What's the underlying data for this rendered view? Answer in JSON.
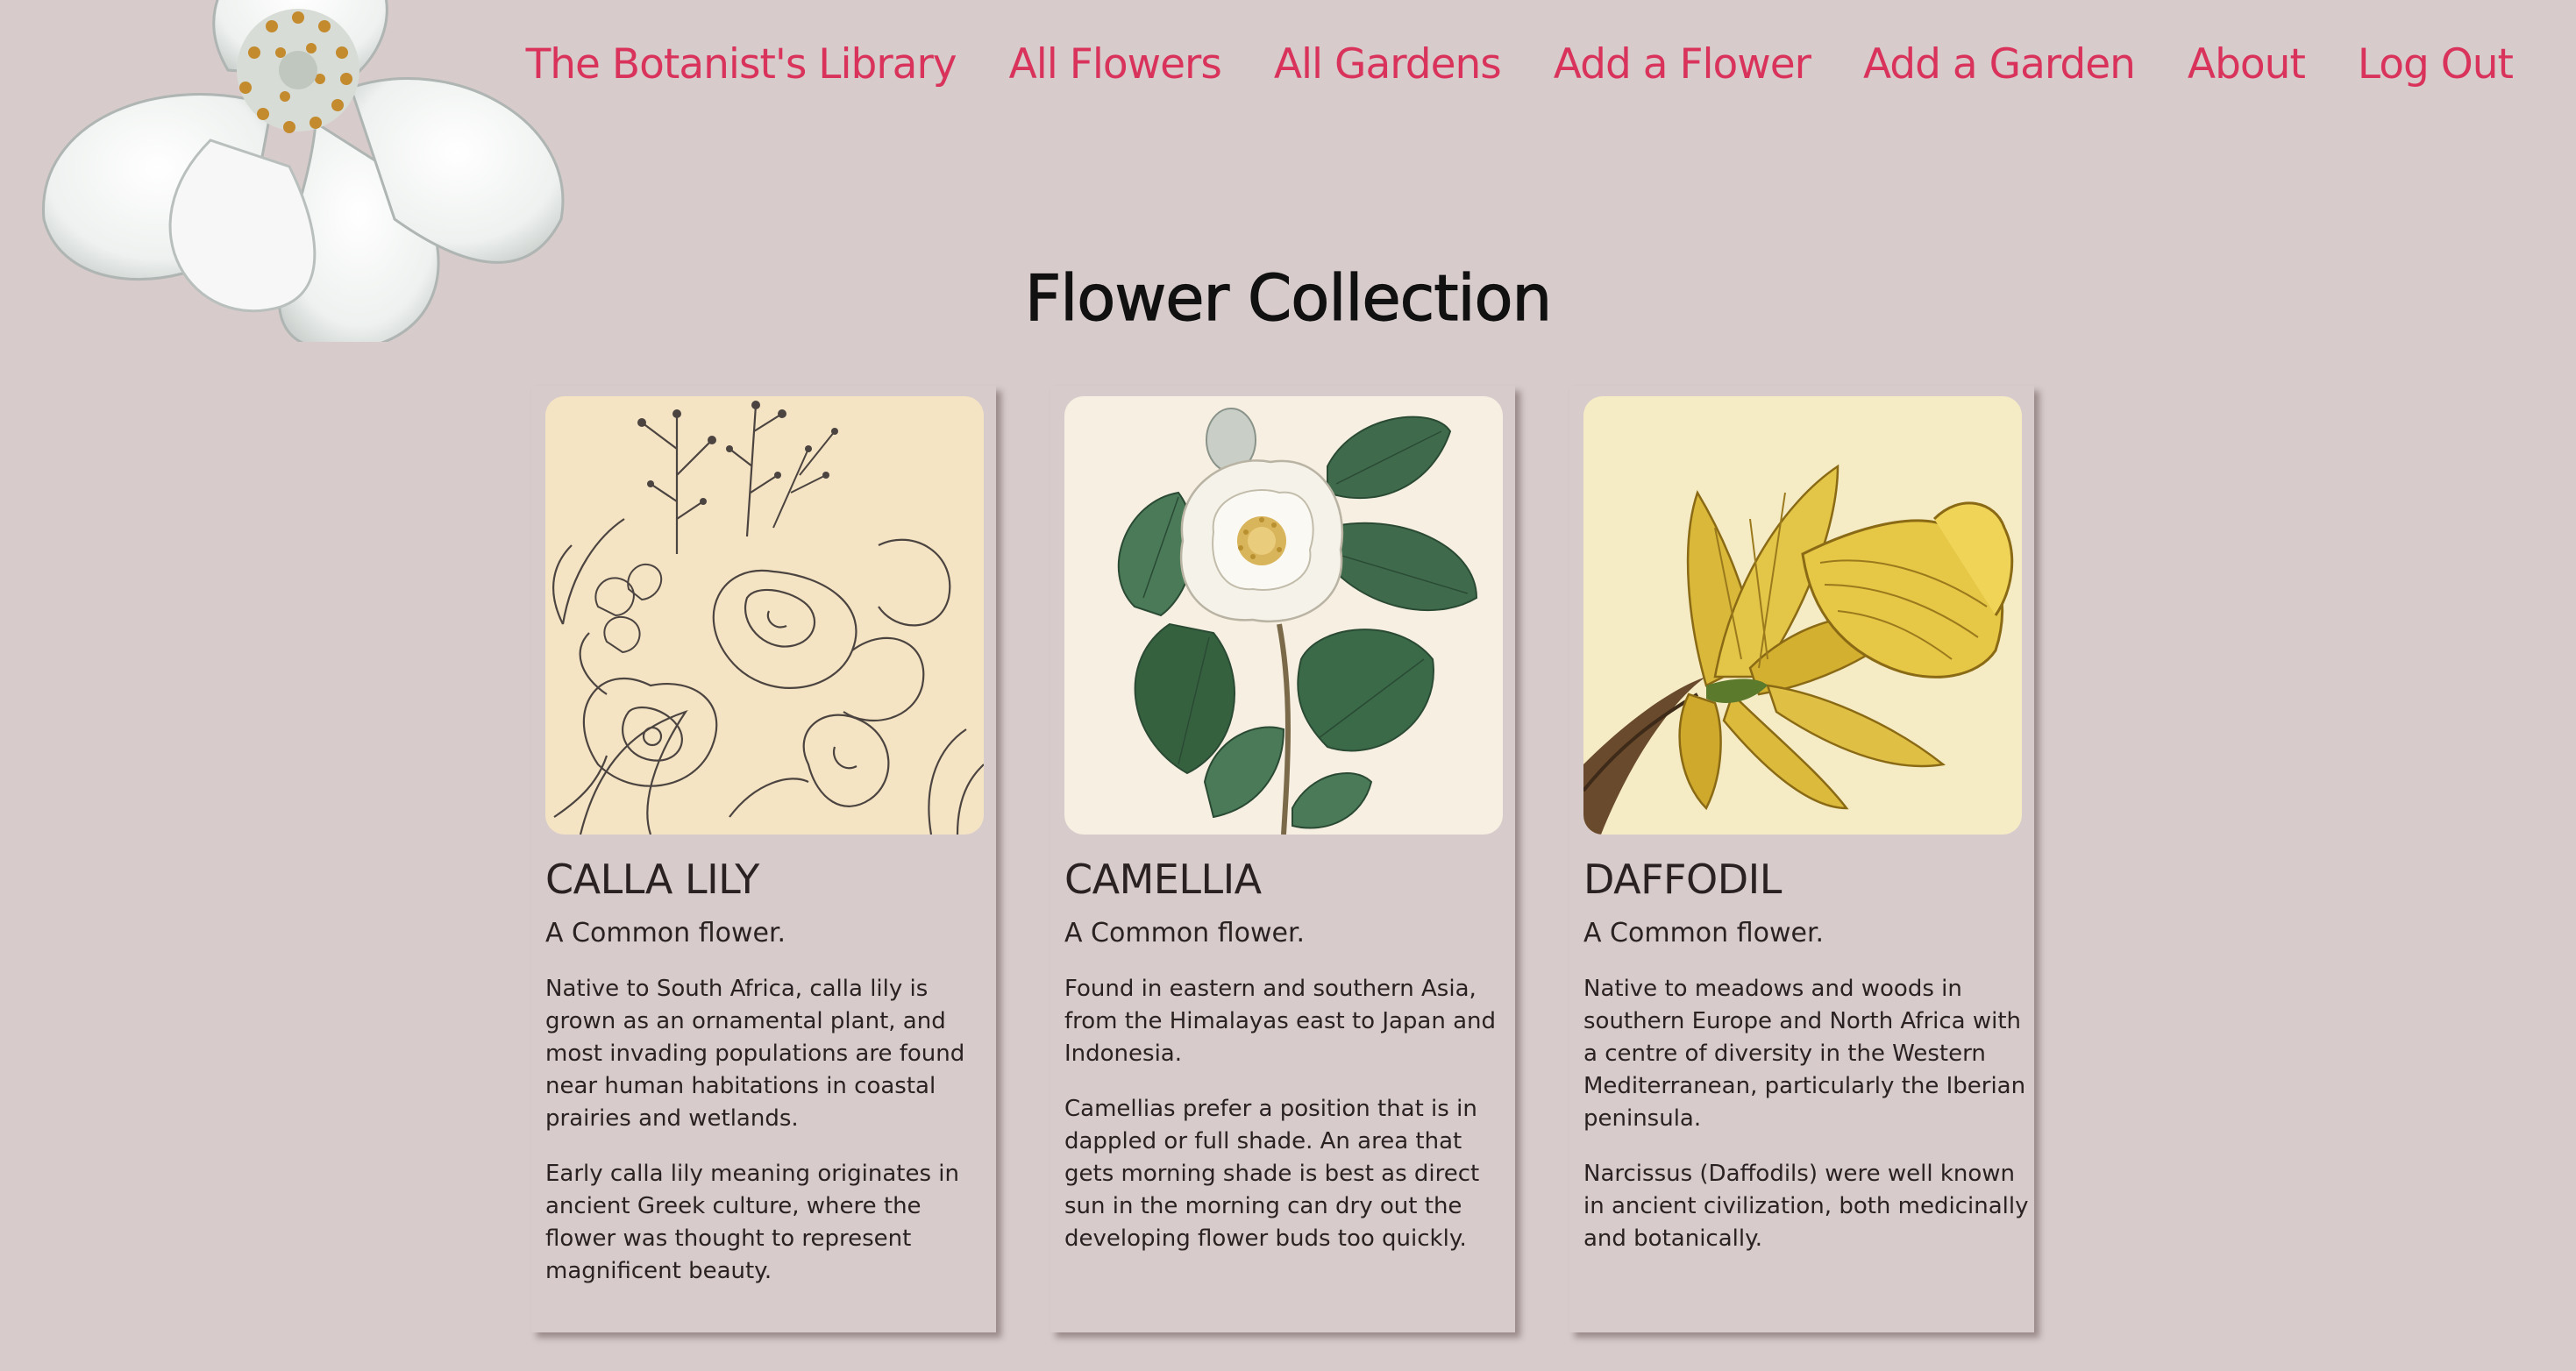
{
  "nav": {
    "brand": "The Botanist's Library",
    "links": [
      "All Flowers",
      "All Gardens",
      "Add a Flower",
      "Add a Garden",
      "About",
      "Log Out"
    ]
  },
  "page": {
    "title": "Flower Collection"
  },
  "cards": [
    {
      "name": "CALLA LILY",
      "subtitle": "A Common flower.",
      "paragraphs": [
        "Native to South Africa, calla lily is grown as an ornamental plant, and most invading populations are found near human habitations in coastal prairies and wetlands.",
        "Early calla lily meaning originates in ancient Greek culture, where the flower was thought to represent magnificent beauty."
      ],
      "image_icon": "botanical-line-drawing-icon"
    },
    {
      "name": "CAMELLIA",
      "subtitle": "A Common flower.",
      "paragraphs": [
        "Found in eastern and southern Asia, from the Himalayas east to Japan and Indonesia.",
        "Camellias prefer a position that is in dappled or full shade. An area that gets morning shade is best as direct sun in the morning can dry out the developing flower buds too quickly."
      ],
      "image_icon": "camellia-illustration-icon"
    },
    {
      "name": "DAFFODIL",
      "subtitle": "A Common flower.",
      "paragraphs": [
        "Native to meadows and woods in southern Europe and North Africa with a centre of diversity in the Western Mediterranean, particularly the Iberian peninsula.",
        "Narcissus (Daffodils) were well known in ancient civilization, both medicinally and botanically."
      ],
      "image_icon": "daffodil-illustration-icon"
    }
  ],
  "colors": {
    "background": "#d7cbcb",
    "nav_link": "#d9335c",
    "title": "#111111",
    "body_text": "#2a2222"
  }
}
